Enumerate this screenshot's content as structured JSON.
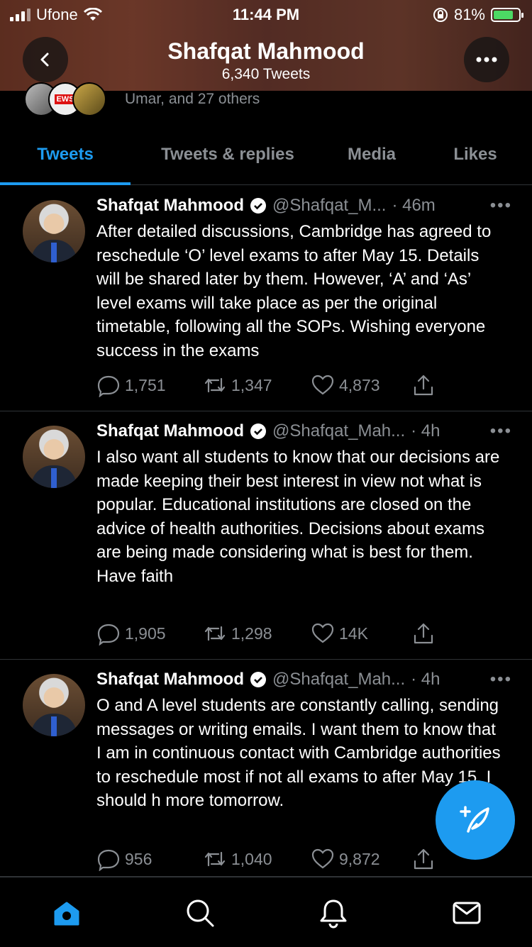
{
  "status": {
    "carrier": "Ufone",
    "time": "11:44 PM",
    "battery": "81%",
    "battery_level": 0.81
  },
  "header": {
    "title": "Shafqat Mahmood",
    "subtitle": "6,340 Tweets"
  },
  "followers": {
    "text": "Umar, and 27 others",
    "avatar_label": "EWS"
  },
  "tabs": [
    "Tweets",
    "Tweets & replies",
    "Media",
    "Likes"
  ],
  "tweets": [
    {
      "name": "Shafqat Mahmood",
      "handle": "@Shafqat_M...",
      "time": "· 46m",
      "text": "After detailed discussions, Cambridge has agreed to reschedule ‘O’ level exams to after May 15. Details will be shared later by them. However, ‘A’ and ‘As’ level exams will take place as per the original timetable, following all the SOPs. Wishing everyone success in the exams",
      "replies": "1,751",
      "retweets": "1,347",
      "likes": "4,873"
    },
    {
      "name": "Shafqat Mahmood",
      "handle": "@Shafqat_Mah...",
      "time": "· 4h",
      "text": "I also want all students to know that our decisions are made keeping their best interest in view not what is popular. Educational institutions are closed on the advice of health authorities. Decisions about exams are being made considering what is best for them. Have faith",
      "replies": "1,905",
      "retweets": "1,298",
      "likes": "14K"
    },
    {
      "name": "Shafqat Mahmood",
      "handle": "@Shafqat_Mah...",
      "time": "· 4h",
      "text": "O and A level students are constantly calling, sending messages or writing emails. I want them to know that I am in continuous contact with Cambridge authorities to reschedule most if not all exams to after May 15. I should h more tomorrow.",
      "replies": "956",
      "retweets": "1,040",
      "likes": "9,872"
    }
  ],
  "colors": {
    "accent": "#1d9bf0",
    "muted": "#8b8f94",
    "background": "#000000",
    "divider": "#2f3336"
  },
  "icons": [
    "back-icon",
    "more-icon",
    "verified-icon",
    "reply-icon",
    "retweet-icon",
    "like-icon",
    "share-icon",
    "home-icon",
    "search-icon",
    "notifications-icon",
    "messages-icon",
    "compose-icon"
  ]
}
